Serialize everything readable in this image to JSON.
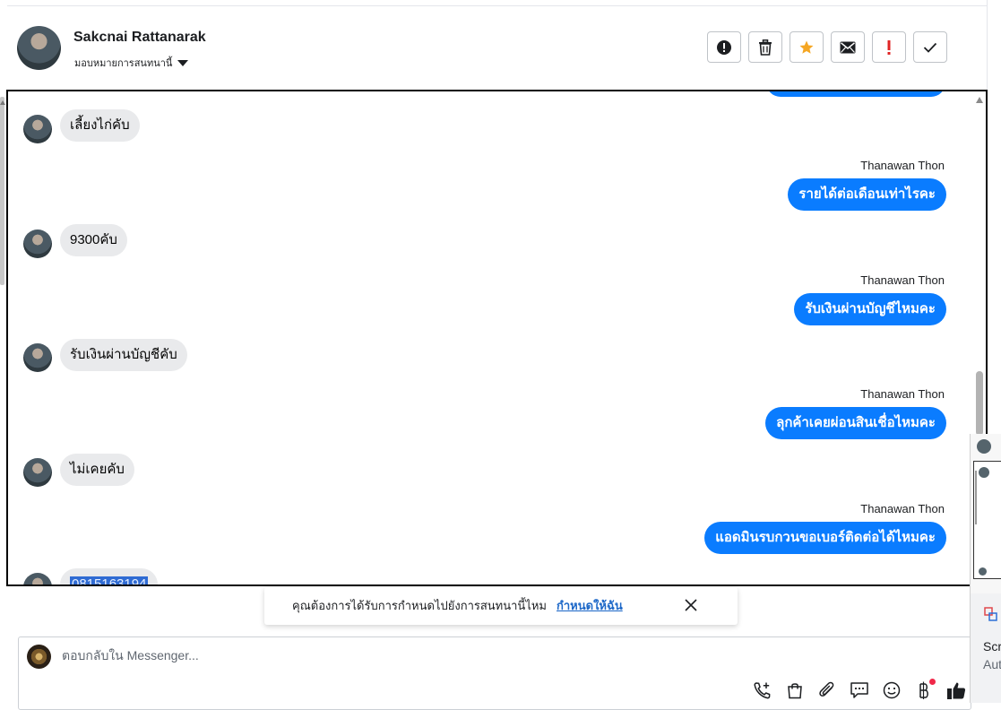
{
  "header": {
    "contact_name": "Sakcnai Rattanarak",
    "assign_label": "มอบหมายการสนทนานี้",
    "actions": [
      {
        "name": "report",
        "icon": "alert-circle-icon"
      },
      {
        "name": "delete",
        "icon": "trash-icon"
      },
      {
        "name": "star",
        "icon": "star-icon",
        "color": "#f5a623"
      },
      {
        "name": "unread",
        "icon": "envelope-icon"
      },
      {
        "name": "priority",
        "icon": "exclamation-icon",
        "color": "#e02424"
      },
      {
        "name": "done",
        "icon": "check-icon"
      }
    ]
  },
  "conversation": {
    "messages": [
      {
        "from": "customer",
        "text": "เลี้ยงไก่คับ"
      },
      {
        "from": "page",
        "sender": "Thanawan Thon",
        "text": "รายได้ต่อเดือนเท่าไรคะ"
      },
      {
        "from": "customer",
        "text": "9300คับ"
      },
      {
        "from": "page",
        "sender": "Thanawan Thon",
        "text": "รับเงินผ่านบัญชีไหมคะ"
      },
      {
        "from": "customer",
        "text": "รับเงินผ่านบัญชีคับ"
      },
      {
        "from": "page",
        "sender": "Thanawan Thon",
        "text": "ลุกค้าเคยผ่อนสินเชื่อไหมคะ"
      },
      {
        "from": "customer",
        "text": "ไม่เคยคับ"
      },
      {
        "from": "page",
        "sender": "Thanawan Thon",
        "text": "แอดมินรบกวนขอเบอร์ติดต่อได้ไหมคะ"
      },
      {
        "from": "customer",
        "text": "0815163194"
      }
    ]
  },
  "toast": {
    "text": "คุณต้องการได้รับการกำหนดไปยังการสนทนานี้ไหม",
    "link": "กำหนดให้ฉัน"
  },
  "composer": {
    "placeholder": "ตอบกลับใน Messenger...",
    "tools": [
      "phone-plus-icon",
      "shopping-bag-icon",
      "paperclip-icon",
      "chat-bubble-icon",
      "smiley-icon",
      "baht-icon",
      "thumbs-up-icon"
    ]
  },
  "side_window": {
    "title": "Scre",
    "subtitle": "Aut"
  },
  "colors": {
    "outgoing_bubble": "#0a7cff",
    "incoming_bubble": "#e9eaec",
    "link": "#1d68c8"
  }
}
